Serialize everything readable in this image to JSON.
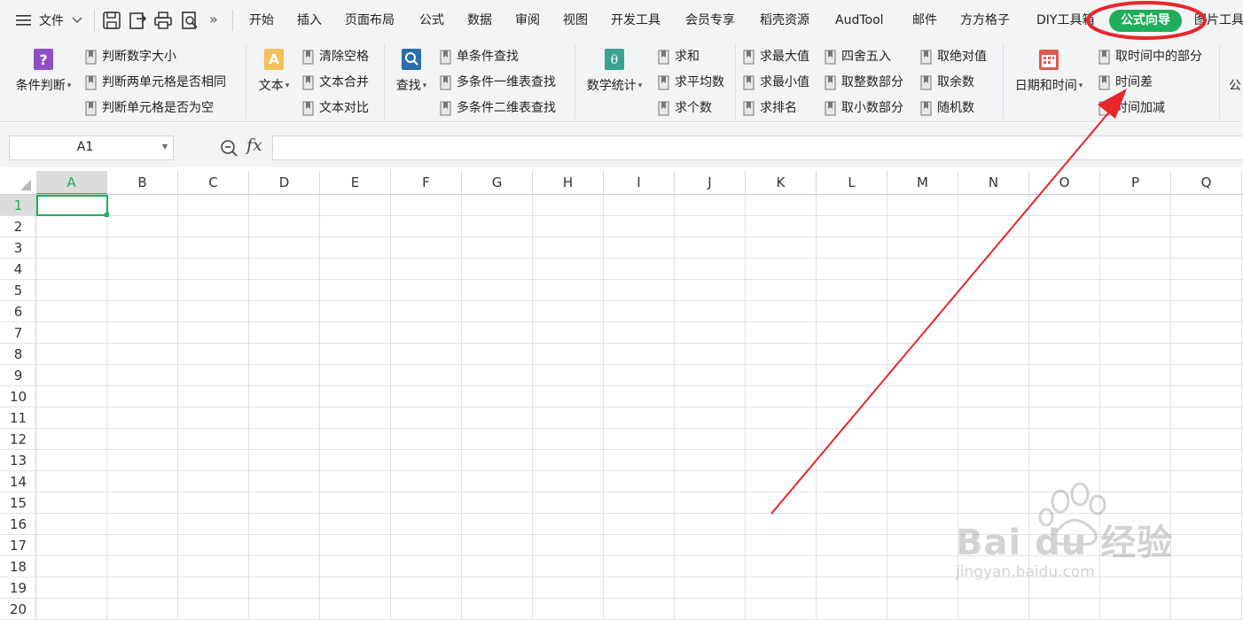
{
  "menu": {
    "file_label": "文件",
    "tabs": [
      "开始",
      "插入",
      "页面布局",
      "公式",
      "数据",
      "审阅",
      "视图",
      "开发工具",
      "会员专享",
      "稻壳资源",
      "AudTool",
      "邮件",
      "方方格子",
      "DIY工具箱",
      "公式向导",
      "图片工具"
    ],
    "active_tab": "公式向导",
    "more_label": "»"
  },
  "ribbon": {
    "condition": {
      "label": "条件判断",
      "items": [
        "判断数字大小",
        "判断两单元格是否相同",
        "判断单元格是否为空"
      ]
    },
    "text": {
      "label": "文本",
      "items": [
        "清除空格",
        "文本合并",
        "文本对比"
      ]
    },
    "find": {
      "label": "查找",
      "items": [
        "单条件查找",
        "多条件一维表查找",
        "多条件二维表查找"
      ]
    },
    "math": {
      "label": "数学统计",
      "items_a": [
        "求和",
        "求平均数",
        "求个数"
      ],
      "items_b": [
        "求最大值",
        "求最小值",
        "求排名"
      ],
      "items_c": [
        "四舍五入",
        "取整数部分",
        "取小数部分"
      ],
      "items_d": [
        "取绝对值",
        "取余数",
        "随机数"
      ]
    },
    "datetime": {
      "label": "日期和时间",
      "items": [
        "取时间中的部分",
        "时间差",
        "时间加减"
      ]
    },
    "overflow_label": "公"
  },
  "formula_bar": {
    "cell_ref": "A1",
    "fx_label": "fx",
    "value": ""
  },
  "sheet": {
    "columns": [
      "A",
      "B",
      "C",
      "D",
      "E",
      "F",
      "G",
      "H",
      "I",
      "J",
      "K",
      "L",
      "M",
      "N",
      "O",
      "P",
      "Q"
    ],
    "rows": [
      "1",
      "2",
      "3",
      "4",
      "5",
      "6",
      "7",
      "8",
      "9",
      "10",
      "11",
      "12",
      "13",
      "14",
      "15",
      "16",
      "17",
      "18",
      "19",
      "20"
    ],
    "selected_cell": "A1"
  },
  "watermark": {
    "brand": "Bai du 经验",
    "url": "jingyan.baidu.com"
  },
  "colors": {
    "accent": "#1fae5b",
    "annotation": "#e8262c"
  },
  "icons": [
    "menu-icon",
    "chevron-down-icon",
    "save-icon",
    "export-pdf-icon",
    "print-icon",
    "print-preview-icon",
    "bookmark-icon"
  ]
}
